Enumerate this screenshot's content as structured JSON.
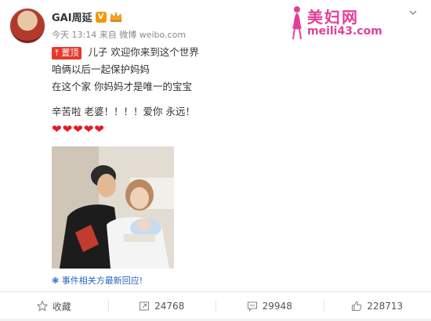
{
  "user": {
    "name": "GAI周延",
    "vip_mark": "V"
  },
  "post_meta": {
    "time": "今天 13:14",
    "source_prefix": "来自",
    "source": "微博 weibo.com"
  },
  "watermark": {
    "title": "美妇网",
    "url": "meili43.com"
  },
  "post": {
    "pin_label": "置顶",
    "lines": [
      "儿子 欢迎你来到这个世界",
      "咱俩以后一起保护妈妈",
      "在这个家 你妈妈才是唯一的宝宝",
      "辛苦啦 老婆！！！！爱你 永远！"
    ],
    "hearts": "❤❤❤❤❤"
  },
  "event_link": "事件相关方最新回应!",
  "actions": {
    "favorite": "收藏",
    "repost_count": "24768",
    "comment_count": "29948",
    "like_count": "228713"
  },
  "colors": {
    "accent_red": "#e43a2d",
    "link_blue": "#2a66c2",
    "watermark_pink": "#e0409a"
  }
}
